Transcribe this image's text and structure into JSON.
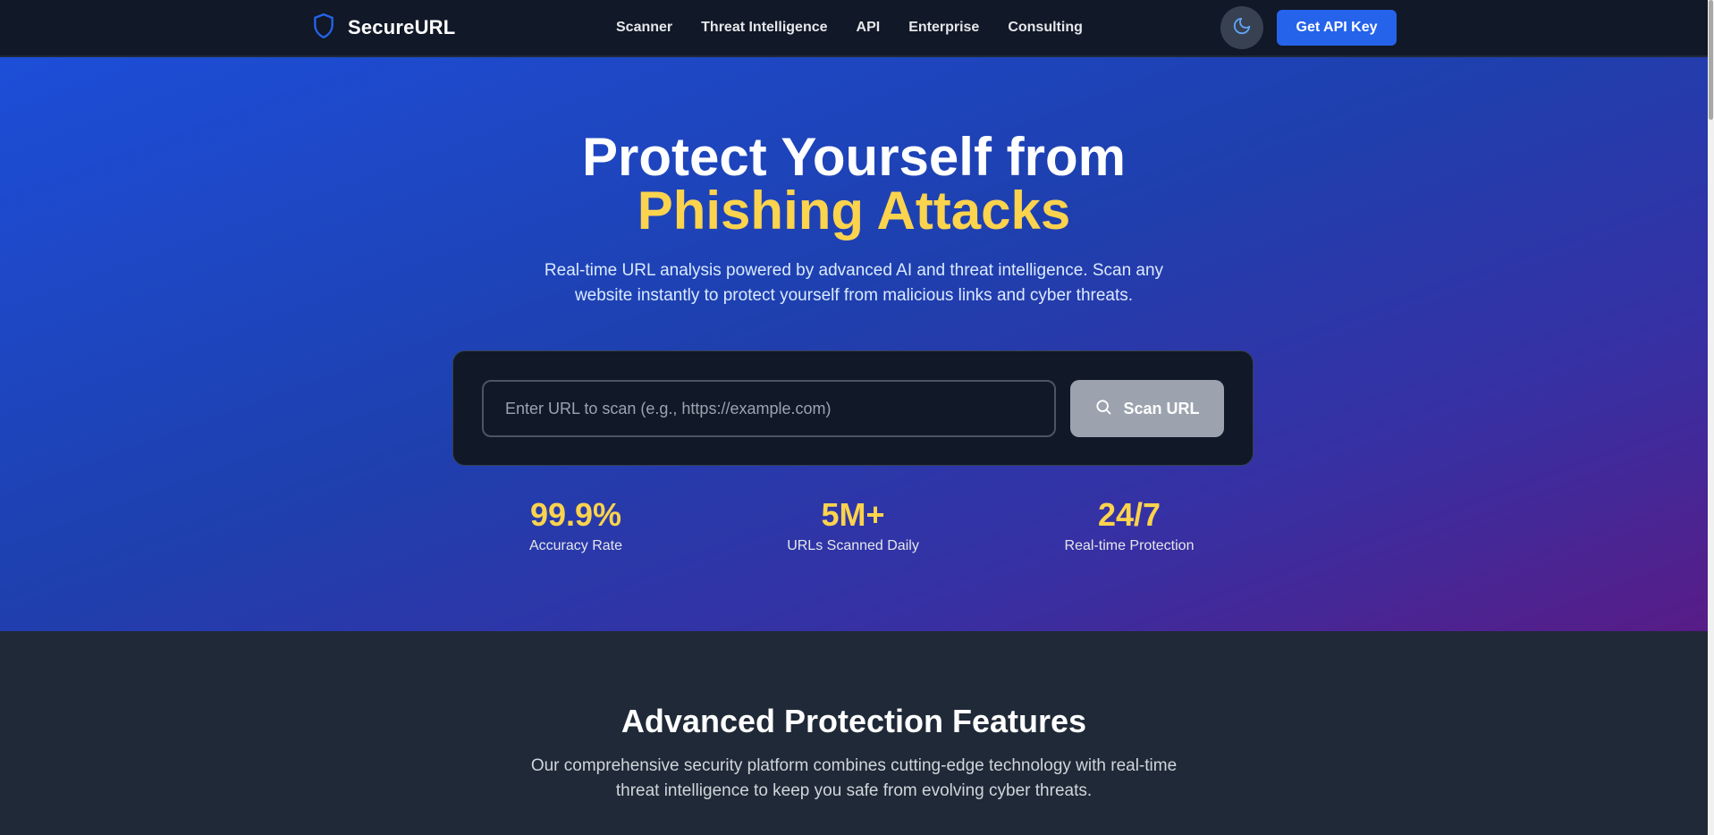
{
  "brand": {
    "name": "SecureURL",
    "icon": "shield-icon"
  },
  "nav": {
    "links": [
      "Scanner",
      "Threat Intelligence",
      "API",
      "Enterprise",
      "Consulting"
    ],
    "theme_toggle_icon": "moon-icon",
    "cta_label": "Get API Key"
  },
  "hero": {
    "title_line1": "Protect Yourself from",
    "title_line2": "Phishing Attacks",
    "subtitle": "Real-time URL analysis powered by advanced AI and threat intelligence. Scan any website instantly to protect yourself from malicious links and cyber threats.",
    "search": {
      "placeholder": "Enter URL to scan (e.g., https://example.com)",
      "value": "",
      "button_label": "Scan URL",
      "button_icon": "search-icon"
    },
    "stats": [
      {
        "value": "99.9%",
        "label": "Accuracy Rate"
      },
      {
        "value": "5M+",
        "label": "URLs Scanned Daily"
      },
      {
        "value": "24/7",
        "label": "Real-time Protection"
      }
    ]
  },
  "features": {
    "title": "Advanced Protection Features",
    "subtitle": "Our comprehensive security platform combines cutting-edge technology with real-time threat intelligence to keep you safe from evolving cyber threats."
  },
  "colors": {
    "accent": "#2563eb",
    "highlight": "#fcd34d",
    "nav_bg": "#111827",
    "section_bg": "#1f2937"
  }
}
